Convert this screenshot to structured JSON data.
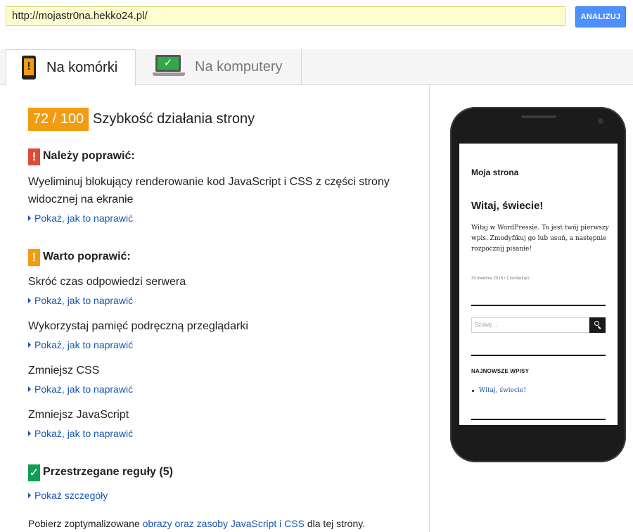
{
  "url_bar": {
    "value": "http://mojastr0na.hekko24.pl/",
    "analyze_label": "ANALIZUJ"
  },
  "tabs": [
    {
      "label": "Na komórki",
      "icon": "mobile-phone-warning-icon",
      "active": true
    },
    {
      "label": "Na komputery",
      "icon": "desktop-laptop-check-icon",
      "active": false
    }
  ],
  "score": {
    "value": "72 / 100",
    "title": "Szybkość działania strony",
    "color": "#f39c12"
  },
  "sections": {
    "must_fix": {
      "title": "Należy poprawić:",
      "icon_glyph": "!",
      "color": "#dd4b39",
      "rules": [
        {
          "text": "Wyeliminuj blokujący renderowanie kod JavaScript i CSS z części strony widocznej na ekranie",
          "link": "Pokaż, jak to naprawić"
        }
      ]
    },
    "should_fix": {
      "title": "Warto poprawić:",
      "icon_glyph": "!",
      "color": "#f39c12",
      "rules": [
        {
          "text": "Skróć czas odpowiedzi serwera",
          "link": "Pokaż, jak to naprawić"
        },
        {
          "text": "Wykorzystaj pamięć podręczną przeglądarki",
          "link": "Pokaż, jak to naprawić"
        },
        {
          "text": "Zmniejsz CSS",
          "link": "Pokaż, jak to naprawić"
        },
        {
          "text": "Zmniejsz JavaScript",
          "link": "Pokaż, jak to naprawić"
        }
      ]
    },
    "passed": {
      "title": "Przestrzegane reguły (5)",
      "icon_glyph": "✓",
      "color": "#0f9d58",
      "link": "Pokaż szczegóły"
    }
  },
  "footer": {
    "prefix": "Pobierz zoptymalizowane ",
    "link": "obrazy oraz zasoby JavaScript i CSS",
    "suffix": " dla tej strony."
  },
  "preview": {
    "site_title": "Moja strona",
    "post_title": "Witaj, świecie!",
    "post_body": "Witaj w WordPressie. To jest twój pierwszy wpis. Zmodyfikuj go lub usuń, a następnie rozpocznij pisanie!",
    "post_meta": "20 kwietnia 2016  /  1 komentarz",
    "search_placeholder": "Szukaj …",
    "widget_title": "NAJNOWSZE WPISY",
    "widget_link": "Witaj, świecie!"
  }
}
